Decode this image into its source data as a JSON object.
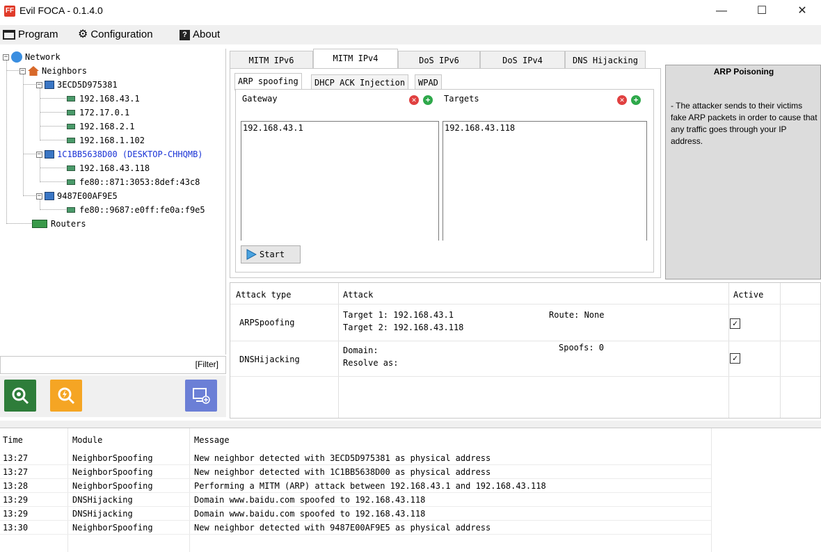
{
  "window": {
    "title": "Evil FOCA - 0.1.4.0",
    "app_icon_glyph": "FF",
    "minimize": "—",
    "maximize": "☐",
    "close": "✕"
  },
  "menu": {
    "items": [
      {
        "label": "Program",
        "icon": "window-icon"
      },
      {
        "label": "Configuration",
        "icon": "gear-icon"
      },
      {
        "label": "About",
        "icon": "help-icon"
      }
    ]
  },
  "tree": {
    "root": "Network",
    "neighbors": "Neighbors",
    "devices": [
      {
        "mac": "3ECD5D975381",
        "ips": [
          "192.168.43.1",
          "172.17.0.1",
          "192.168.2.1",
          "192.168.1.102"
        ]
      },
      {
        "mac": "1C1BB5638D00 (DESKTOP-CHHQMB)",
        "ips": [
          "192.168.43.118",
          "fe80::871:3053:8def:43c8"
        ]
      },
      {
        "mac": "9487E00AF9E5",
        "ips": [
          "fe80::9687:e0ff:fe0a:f9e5"
        ]
      }
    ],
    "routers": "Routers",
    "expanded_glyph": "−"
  },
  "filter": {
    "label": "[Filter]"
  },
  "tabs": [
    "MITM IPv6",
    "MITM IPv4",
    "DoS IPv6",
    "DoS IPv4",
    "DNS Hijacking"
  ],
  "subtabs": [
    "ARP spoofing",
    "DHCP ACK Injection",
    "WPAD"
  ],
  "arp": {
    "gateway_label": "Gateway",
    "targets_label": "Targets",
    "gateway_list": [
      "192.168.43.1"
    ],
    "targets_list": [
      "192.168.43.118"
    ],
    "remove_glyph": "✕",
    "add_glyph": "+",
    "start_label": "Start"
  },
  "info": {
    "title": "ARP Poisoning",
    "text": "- The attacker sends to their victims fake ARP packets in order to cause that any traffic goes through your IP address."
  },
  "attacks": {
    "headers": {
      "type": "Attack type",
      "attack": "Attack",
      "active": "Active"
    },
    "check_glyph": "✓",
    "rows": [
      {
        "type": "ARPSpoofing",
        "line1": "Target 1: 192.168.43.1",
        "line2": "Target 2: 192.168.43.118",
        "extra": "Route: None",
        "active": true
      },
      {
        "type": "DNSHijacking",
        "line1": "Domain:",
        "line2": "Resolve as:",
        "extra": "Spoofs: 0",
        "active": true
      }
    ]
  },
  "log": {
    "headers": {
      "time": "Time",
      "module": "Module",
      "message": "Message"
    },
    "rows": [
      {
        "time": "13:27",
        "module": "NeighborSpoofing",
        "message": "New neighbor detected with 3ECD5D975381 as physical address"
      },
      {
        "time": "13:27",
        "module": "NeighborSpoofing",
        "message": "New neighbor detected with 1C1BB5638D00 as physical address"
      },
      {
        "time": "13:28",
        "module": "NeighborSpoofing",
        "message": "Performing a MITM (ARP) attack between 192.168.43.1 and 192.168.43.118"
      },
      {
        "time": "13:29",
        "module": "DNSHijacking",
        "message": "Domain www.baidu.com spoofed to 192.168.43.118"
      },
      {
        "time": "13:29",
        "module": "DNSHijacking",
        "message": "Domain www.baidu.com spoofed to 192.168.43.118"
      },
      {
        "time": "13:30",
        "module": "NeighborSpoofing",
        "message": "New neighbor detected with 9487E00AF9E5 as physical address"
      }
    ]
  },
  "colors": {
    "selected_node": "#1a33d6",
    "scan_green": "#2e7d3a",
    "scan_orange": "#f5a524",
    "add_purple": "#6b7fd6"
  }
}
